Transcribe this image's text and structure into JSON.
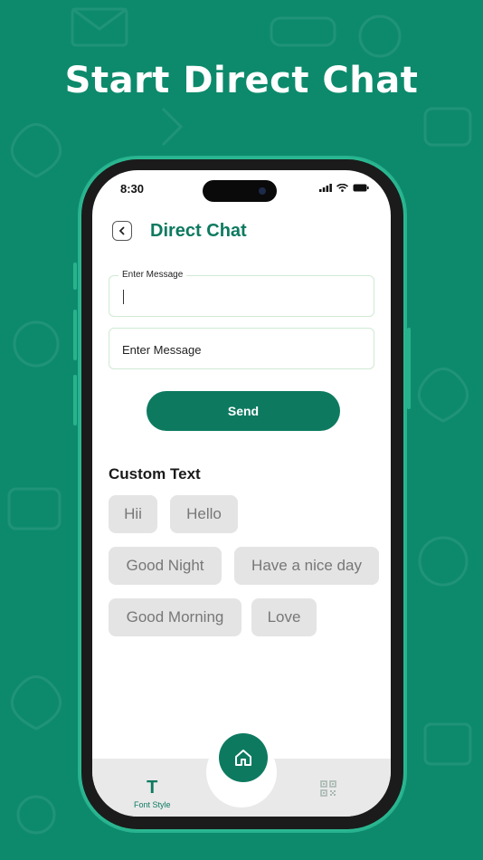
{
  "promo": {
    "headline": "Start Direct Chat"
  },
  "status_bar": {
    "time": "8:30"
  },
  "header": {
    "title": "Direct Chat"
  },
  "form": {
    "message_legend": "Enter Message",
    "message_value": "",
    "second_placeholder": "Enter Message",
    "send_label": "Send"
  },
  "custom_text": {
    "title": "Custom Text",
    "chips": [
      "Hii",
      "Hello",
      "Good Night",
      "Have a nice day",
      "Good Morning",
      "Love"
    ]
  },
  "bottom_nav": {
    "font_style_label": "Font Style",
    "font_style_glyph": "T",
    "icons": [
      "home-icon",
      "qr-code-icon"
    ]
  },
  "colors": {
    "brand": "#0d8a6c",
    "accent": "#0d7a60",
    "chip_bg": "#e4e4e4"
  }
}
